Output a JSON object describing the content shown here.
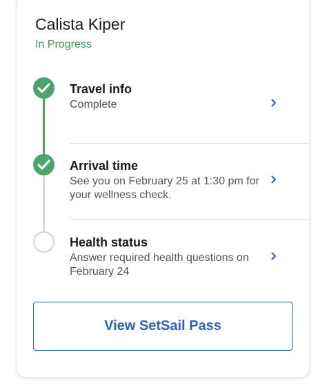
{
  "person": {
    "name": "Calista Kiper",
    "status": "In Progress"
  },
  "steps": [
    {
      "title": "Travel info",
      "description": "Complete",
      "state": "complete",
      "icon": "check-icon"
    },
    {
      "title": "Arrival time",
      "description": "See you on February 25 at 1:30 pm for your wellness check.",
      "state": "complete",
      "icon": "check-icon"
    },
    {
      "title": "Health status",
      "description": "Answer required health questions on February 24",
      "state": "incomplete",
      "icon": "empty-circle-icon"
    }
  ],
  "actions": {
    "view_pass_label": "View SetSail Pass"
  },
  "colors": {
    "status_green": "#3e9a61",
    "complete_green": "#4aa56a",
    "link_blue": "#2b62bd",
    "inactive_gray": "#d4d4d4"
  },
  "icons": {
    "chevron": "chevron-right-icon"
  }
}
